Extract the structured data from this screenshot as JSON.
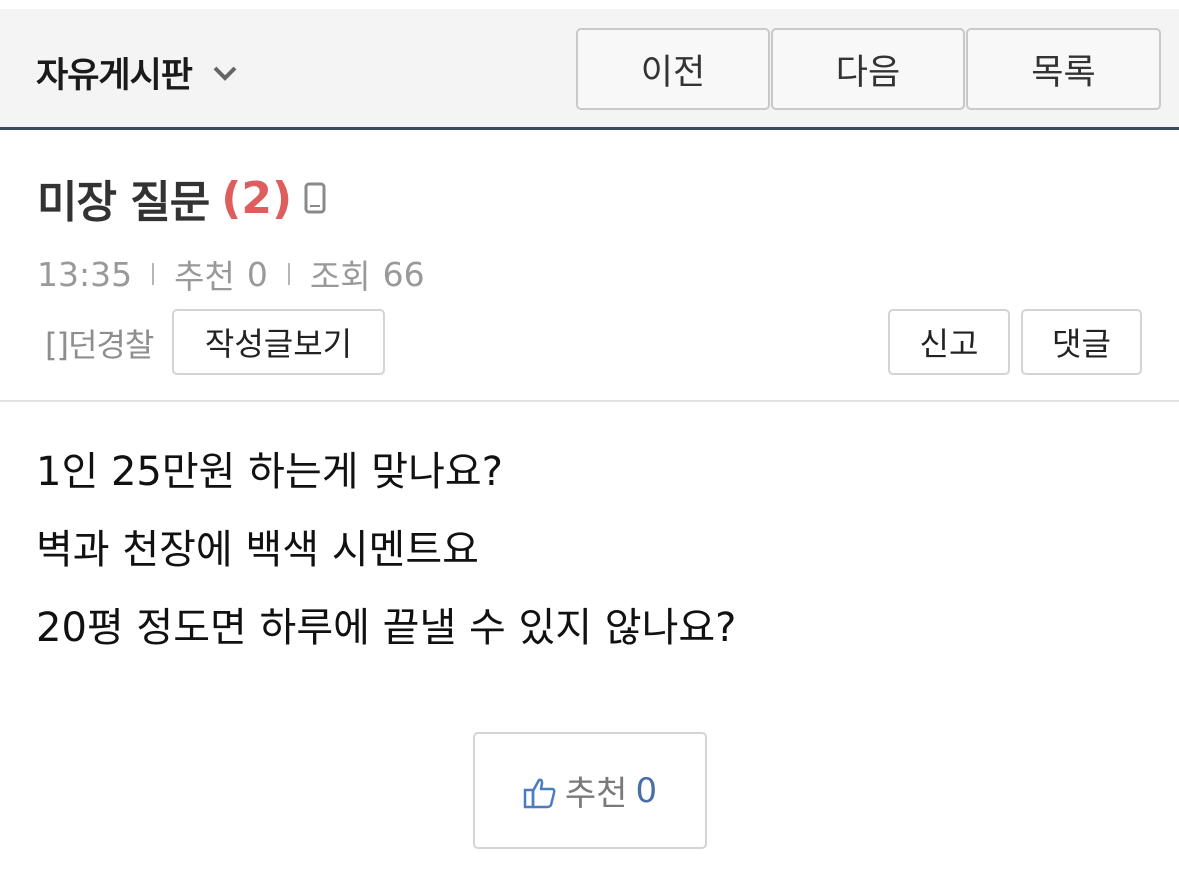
{
  "header": {
    "board_name": "자유게시판",
    "prev_label": "이전",
    "next_label": "다음",
    "list_label": "목록"
  },
  "post": {
    "title": "미장 질문",
    "comment_count": "(2)",
    "time": "13:35",
    "recommend_label": "추천",
    "recommend_count": "0",
    "views_label": "조회",
    "views_count": "66",
    "author": "[]던경찰",
    "view_posts_label": "작성글보기",
    "report_label": "신고",
    "comment_label": "댓글",
    "body": [
      "1인 25만원 하는게 맞나요?",
      "벽과 천장에 백색 시멘트요",
      "20평 정도면 하루에 끝낼 수 있지 않나요?"
    ]
  },
  "recommend_box": {
    "label": "추천",
    "count": "0"
  },
  "icons": {
    "board_dropdown": "chevron-down-icon",
    "mobile": "mobile-phone-icon",
    "thumb": "thumbs-up-icon"
  },
  "colors": {
    "header_bg": "#f4f4f4",
    "header_border": "#3b4a5e",
    "comment_count": "#de5d5d",
    "recommend_count": "#4a6fa5",
    "meta_text": "#999999"
  }
}
